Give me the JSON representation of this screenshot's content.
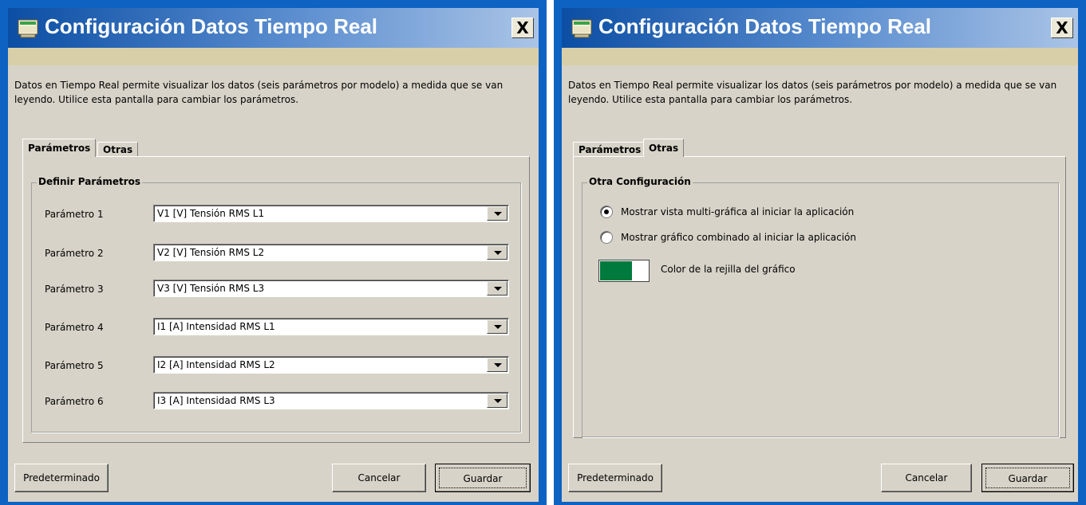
{
  "dialogs": [
    {
      "title": "Configuración Datos Tiempo Real",
      "close_label": "X",
      "description": "Datos en Tiempo Real permite visualizar los datos (seis parámetros por modelo) a medida que se van leyendo. Utilice esta pantalla para cambiar los parámetros.",
      "tabs": [
        "Parámetros",
        "Otras"
      ],
      "active_tab": "Parámetros",
      "group_title": "Definir Parámetros",
      "parameters": [
        {
          "label": "Parámetro 1",
          "value": "V1 [V] Tensión RMS L1"
        },
        {
          "label": "Parámetro 2",
          "value": "V2 [V] Tensión RMS L2"
        },
        {
          "label": "Parámetro 3",
          "value": "V3 [V] Tensión RMS L3"
        },
        {
          "label": "Parámetro 4",
          "value": "I1 [A] Intensidad RMS L1"
        },
        {
          "label": "Parámetro 5",
          "value": "I2 [A] Intensidad RMS L2"
        },
        {
          "label": "Parámetro 6",
          "value": "I3 [A] Intensidad RMS L3"
        }
      ],
      "buttons": {
        "default": "Predeterminado",
        "cancel": "Cancelar",
        "save": "Guardar"
      }
    },
    {
      "title": "Configuración Datos Tiempo Real",
      "close_label": "X",
      "description": "Datos en Tiempo Real permite visualizar los datos (seis parámetros por modelo) a medida que se van leyendo. Utilice esta pantalla para cambiar los parámetros.",
      "tabs": [
        "Parámetros",
        "Otras"
      ],
      "active_tab": "Otras",
      "group_title": "Otra Configuración",
      "options": [
        {
          "label": "Mostrar vista multi-gráfica al iniciar la aplicación",
          "selected": true
        },
        {
          "label": "Mostrar gráfico combinado al iniciar la aplicación",
          "selected": false
        }
      ],
      "grid_color_label": "Color de la rejilla del gráfico",
      "grid_color": "#007a3d",
      "buttons": {
        "default": "Predeterminado",
        "cancel": "Cancelar",
        "save": "Guardar"
      }
    }
  ],
  "colors": {
    "title_gradient_start": "#0b4ea4",
    "title_gradient_end": "#aac4e6",
    "frame": "#0d62c2",
    "dialog_bg": "#d7d3c8",
    "strip": "#d8cfa9"
  },
  "icons": {
    "app": "app-window-icon",
    "close": "close-icon",
    "dropdown": "chevron-down-icon"
  }
}
